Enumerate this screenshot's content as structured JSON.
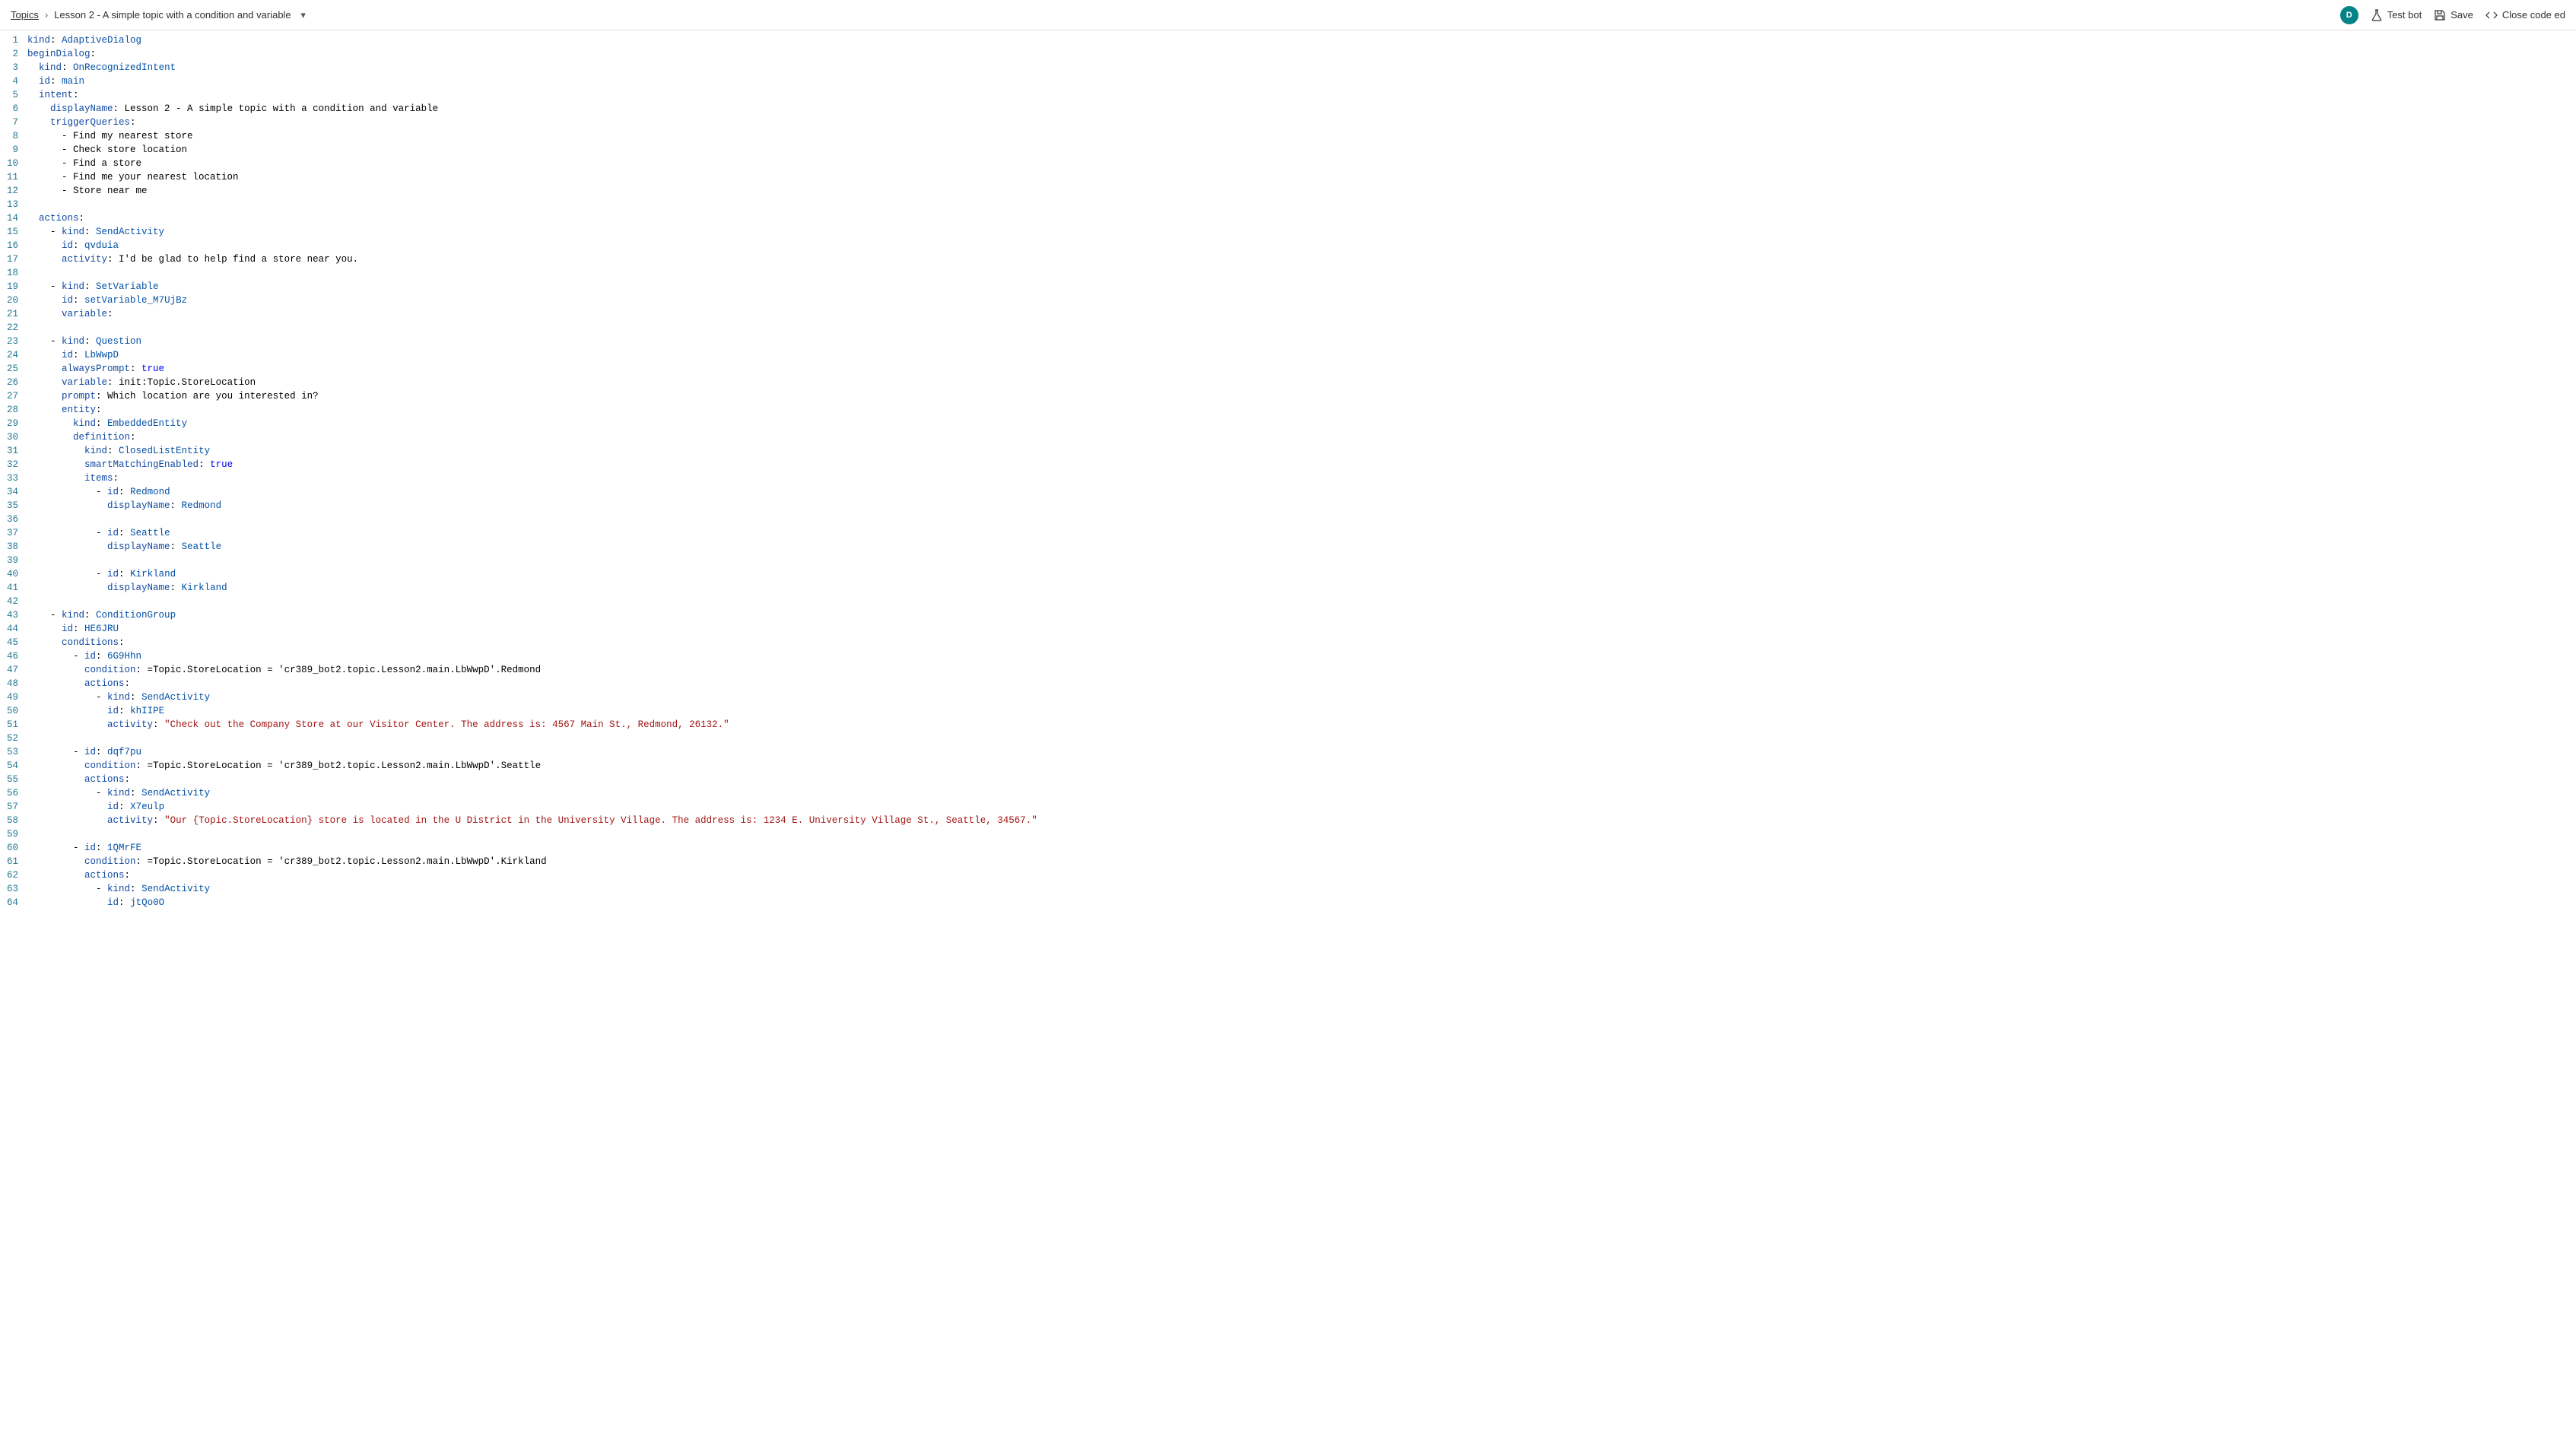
{
  "breadcrumb": {
    "root": "Topics",
    "current": "Lesson 2 - A simple topic with a condition and variable"
  },
  "avatar_initial": "D",
  "toolbar": {
    "test_bot": "Test bot",
    "save": "Save",
    "close_code": "Close code ed"
  },
  "code": {
    "lines": [
      {
        "n": 1,
        "tokens": [
          [
            "k",
            "kind"
          ],
          [
            "p",
            ": "
          ],
          [
            "v",
            "AdaptiveDialog"
          ]
        ]
      },
      {
        "n": 2,
        "tokens": [
          [
            "k",
            "beginDialog"
          ],
          [
            "p",
            ":"
          ]
        ]
      },
      {
        "n": 3,
        "tokens": [
          [
            "p",
            "  "
          ],
          [
            "k",
            "kind"
          ],
          [
            "p",
            ": "
          ],
          [
            "v",
            "OnRecognizedIntent"
          ]
        ]
      },
      {
        "n": 4,
        "tokens": [
          [
            "p",
            "  "
          ],
          [
            "k",
            "id"
          ],
          [
            "p",
            ": "
          ],
          [
            "v",
            "main"
          ]
        ]
      },
      {
        "n": 5,
        "tokens": [
          [
            "p",
            "  "
          ],
          [
            "k",
            "intent"
          ],
          [
            "p",
            ":"
          ]
        ]
      },
      {
        "n": 6,
        "tokens": [
          [
            "p",
            "    "
          ],
          [
            "k",
            "displayName"
          ],
          [
            "p",
            ": "
          ],
          [
            "c",
            "Lesson 2 - A simple topic with a condition and variable"
          ]
        ]
      },
      {
        "n": 7,
        "tokens": [
          [
            "p",
            "    "
          ],
          [
            "k",
            "triggerQueries"
          ],
          [
            "p",
            ":"
          ]
        ]
      },
      {
        "n": 8,
        "tokens": [
          [
            "p",
            "      - "
          ],
          [
            "c",
            "Find my nearest store"
          ]
        ]
      },
      {
        "n": 9,
        "tokens": [
          [
            "p",
            "      - "
          ],
          [
            "c",
            "Check store location"
          ]
        ]
      },
      {
        "n": 10,
        "tokens": [
          [
            "p",
            "      - "
          ],
          [
            "c",
            "Find a store"
          ]
        ]
      },
      {
        "n": 11,
        "tokens": [
          [
            "p",
            "      - "
          ],
          [
            "c",
            "Find me your nearest location"
          ]
        ]
      },
      {
        "n": 12,
        "tokens": [
          [
            "p",
            "      - "
          ],
          [
            "c",
            "Store near me"
          ]
        ]
      },
      {
        "n": 13,
        "tokens": []
      },
      {
        "n": 14,
        "tokens": [
          [
            "p",
            "  "
          ],
          [
            "k",
            "actions"
          ],
          [
            "p",
            ":"
          ]
        ]
      },
      {
        "n": 15,
        "tokens": [
          [
            "p",
            "    - "
          ],
          [
            "k",
            "kind"
          ],
          [
            "p",
            ": "
          ],
          [
            "v",
            "SendActivity"
          ]
        ]
      },
      {
        "n": 16,
        "tokens": [
          [
            "p",
            "      "
          ],
          [
            "k",
            "id"
          ],
          [
            "p",
            ": "
          ],
          [
            "v",
            "qvduia"
          ]
        ]
      },
      {
        "n": 17,
        "tokens": [
          [
            "p",
            "      "
          ],
          [
            "k",
            "activity"
          ],
          [
            "p",
            ": "
          ],
          [
            "c",
            "I'd be glad to help find a store near you."
          ]
        ]
      },
      {
        "n": 18,
        "tokens": []
      },
      {
        "n": 19,
        "tokens": [
          [
            "p",
            "    - "
          ],
          [
            "k",
            "kind"
          ],
          [
            "p",
            ": "
          ],
          [
            "v",
            "SetVariable"
          ]
        ]
      },
      {
        "n": 20,
        "tokens": [
          [
            "p",
            "      "
          ],
          [
            "k",
            "id"
          ],
          [
            "p",
            ": "
          ],
          [
            "v",
            "setVariable_M7UjBz"
          ]
        ]
      },
      {
        "n": 21,
        "tokens": [
          [
            "p",
            "      "
          ],
          [
            "k",
            "variable"
          ],
          [
            "p",
            ": "
          ]
        ]
      },
      {
        "n": 22,
        "tokens": []
      },
      {
        "n": 23,
        "tokens": [
          [
            "p",
            "    - "
          ],
          [
            "k",
            "kind"
          ],
          [
            "p",
            ": "
          ],
          [
            "v",
            "Question"
          ]
        ]
      },
      {
        "n": 24,
        "tokens": [
          [
            "p",
            "      "
          ],
          [
            "k",
            "id"
          ],
          [
            "p",
            ": "
          ],
          [
            "v",
            "LbWwpD"
          ]
        ]
      },
      {
        "n": 25,
        "tokens": [
          [
            "p",
            "      "
          ],
          [
            "k",
            "alwaysPrompt"
          ],
          [
            "p",
            ": "
          ],
          [
            "b",
            "true"
          ]
        ]
      },
      {
        "n": 26,
        "tokens": [
          [
            "p",
            "      "
          ],
          [
            "k",
            "variable"
          ],
          [
            "p",
            ": "
          ],
          [
            "c",
            "init:Topic.StoreLocation"
          ]
        ]
      },
      {
        "n": 27,
        "tokens": [
          [
            "p",
            "      "
          ],
          [
            "k",
            "prompt"
          ],
          [
            "p",
            ": "
          ],
          [
            "c",
            "Which location are you interested in?"
          ]
        ]
      },
      {
        "n": 28,
        "tokens": [
          [
            "p",
            "      "
          ],
          [
            "k",
            "entity"
          ],
          [
            "p",
            ":"
          ]
        ]
      },
      {
        "n": 29,
        "tokens": [
          [
            "p",
            "        "
          ],
          [
            "k",
            "kind"
          ],
          [
            "p",
            ": "
          ],
          [
            "v",
            "EmbeddedEntity"
          ]
        ]
      },
      {
        "n": 30,
        "tokens": [
          [
            "p",
            "        "
          ],
          [
            "k",
            "definition"
          ],
          [
            "p",
            ":"
          ]
        ]
      },
      {
        "n": 31,
        "tokens": [
          [
            "p",
            "          "
          ],
          [
            "k",
            "kind"
          ],
          [
            "p",
            ": "
          ],
          [
            "v",
            "ClosedListEntity"
          ]
        ]
      },
      {
        "n": 32,
        "tokens": [
          [
            "p",
            "          "
          ],
          [
            "k",
            "smartMatchingEnabled"
          ],
          [
            "p",
            ": "
          ],
          [
            "b",
            "true"
          ]
        ]
      },
      {
        "n": 33,
        "tokens": [
          [
            "p",
            "          "
          ],
          [
            "k",
            "items"
          ],
          [
            "p",
            ":"
          ]
        ]
      },
      {
        "n": 34,
        "tokens": [
          [
            "p",
            "            - "
          ],
          [
            "k",
            "id"
          ],
          [
            "p",
            ": "
          ],
          [
            "v",
            "Redmond"
          ]
        ]
      },
      {
        "n": 35,
        "tokens": [
          [
            "p",
            "              "
          ],
          [
            "k",
            "displayName"
          ],
          [
            "p",
            ": "
          ],
          [
            "v",
            "Redmond"
          ]
        ]
      },
      {
        "n": 36,
        "tokens": []
      },
      {
        "n": 37,
        "tokens": [
          [
            "p",
            "            - "
          ],
          [
            "k",
            "id"
          ],
          [
            "p",
            ": "
          ],
          [
            "v",
            "Seattle"
          ]
        ]
      },
      {
        "n": 38,
        "tokens": [
          [
            "p",
            "              "
          ],
          [
            "k",
            "displayName"
          ],
          [
            "p",
            ": "
          ],
          [
            "v",
            "Seattle"
          ]
        ]
      },
      {
        "n": 39,
        "tokens": []
      },
      {
        "n": 40,
        "tokens": [
          [
            "p",
            "            - "
          ],
          [
            "k",
            "id"
          ],
          [
            "p",
            ": "
          ],
          [
            "v",
            "Kirkland"
          ]
        ]
      },
      {
        "n": 41,
        "tokens": [
          [
            "p",
            "              "
          ],
          [
            "k",
            "displayName"
          ],
          [
            "p",
            ": "
          ],
          [
            "v",
            "Kirkland"
          ]
        ]
      },
      {
        "n": 42,
        "tokens": []
      },
      {
        "n": 43,
        "tokens": [
          [
            "p",
            "    - "
          ],
          [
            "k",
            "kind"
          ],
          [
            "p",
            ": "
          ],
          [
            "v",
            "ConditionGroup"
          ]
        ]
      },
      {
        "n": 44,
        "tokens": [
          [
            "p",
            "      "
          ],
          [
            "k",
            "id"
          ],
          [
            "p",
            ": "
          ],
          [
            "v",
            "HE6JRU"
          ]
        ]
      },
      {
        "n": 45,
        "tokens": [
          [
            "p",
            "      "
          ],
          [
            "k",
            "conditions"
          ],
          [
            "p",
            ":"
          ]
        ]
      },
      {
        "n": 46,
        "tokens": [
          [
            "p",
            "        - "
          ],
          [
            "k",
            "id"
          ],
          [
            "p",
            ": "
          ],
          [
            "v",
            "6G9Hhn"
          ]
        ]
      },
      {
        "n": 47,
        "tokens": [
          [
            "p",
            "          "
          ],
          [
            "k",
            "condition"
          ],
          [
            "p",
            ": "
          ],
          [
            "c",
            "=Topic.StoreLocation = 'cr389_bot2.topic.Lesson2.main.LbWwpD'.Redmond"
          ]
        ]
      },
      {
        "n": 48,
        "tokens": [
          [
            "p",
            "          "
          ],
          [
            "k",
            "actions"
          ],
          [
            "p",
            ":"
          ]
        ]
      },
      {
        "n": 49,
        "tokens": [
          [
            "p",
            "            - "
          ],
          [
            "k",
            "kind"
          ],
          [
            "p",
            ": "
          ],
          [
            "v",
            "SendActivity"
          ]
        ]
      },
      {
        "n": 50,
        "tokens": [
          [
            "p",
            "              "
          ],
          [
            "k",
            "id"
          ],
          [
            "p",
            ": "
          ],
          [
            "v",
            "khIIPE"
          ]
        ]
      },
      {
        "n": 51,
        "tokens": [
          [
            "p",
            "              "
          ],
          [
            "k",
            "activity"
          ],
          [
            "p",
            ": "
          ],
          [
            "s",
            "\"Check out the Company Store at our Visitor Center. The address is: 4567 Main St., Redmond, 26132.\""
          ]
        ]
      },
      {
        "n": 52,
        "tokens": []
      },
      {
        "n": 53,
        "tokens": [
          [
            "p",
            "        - "
          ],
          [
            "k",
            "id"
          ],
          [
            "p",
            ": "
          ],
          [
            "v",
            "dqf7pu"
          ]
        ]
      },
      {
        "n": 54,
        "tokens": [
          [
            "p",
            "          "
          ],
          [
            "k",
            "condition"
          ],
          [
            "p",
            ": "
          ],
          [
            "c",
            "=Topic.StoreLocation = 'cr389_bot2.topic.Lesson2.main.LbWwpD'.Seattle"
          ]
        ]
      },
      {
        "n": 55,
        "tokens": [
          [
            "p",
            "          "
          ],
          [
            "k",
            "actions"
          ],
          [
            "p",
            ":"
          ]
        ]
      },
      {
        "n": 56,
        "tokens": [
          [
            "p",
            "            - "
          ],
          [
            "k",
            "kind"
          ],
          [
            "p",
            ": "
          ],
          [
            "v",
            "SendActivity"
          ]
        ]
      },
      {
        "n": 57,
        "tokens": [
          [
            "p",
            "              "
          ],
          [
            "k",
            "id"
          ],
          [
            "p",
            ": "
          ],
          [
            "v",
            "X7eulp"
          ]
        ]
      },
      {
        "n": 58,
        "tokens": [
          [
            "p",
            "              "
          ],
          [
            "k",
            "activity"
          ],
          [
            "p",
            ": "
          ],
          [
            "s",
            "\"Our {Topic.StoreLocation} store is located in the U District in the University Village. The address is: 1234 E. University Village St., Seattle, 34567.\""
          ]
        ]
      },
      {
        "n": 59,
        "tokens": []
      },
      {
        "n": 60,
        "tokens": [
          [
            "p",
            "        - "
          ],
          [
            "k",
            "id"
          ],
          [
            "p",
            ": "
          ],
          [
            "v",
            "1QMrFE"
          ]
        ]
      },
      {
        "n": 61,
        "tokens": [
          [
            "p",
            "          "
          ],
          [
            "k",
            "condition"
          ],
          [
            "p",
            ": "
          ],
          [
            "c",
            "=Topic.StoreLocation = 'cr389_bot2.topic.Lesson2.main.LbWwpD'.Kirkland"
          ]
        ]
      },
      {
        "n": 62,
        "tokens": [
          [
            "p",
            "          "
          ],
          [
            "k",
            "actions"
          ],
          [
            "p",
            ":"
          ]
        ]
      },
      {
        "n": 63,
        "tokens": [
          [
            "p",
            "            - "
          ],
          [
            "k",
            "kind"
          ],
          [
            "p",
            ": "
          ],
          [
            "v",
            "SendActivity"
          ]
        ]
      },
      {
        "n": 64,
        "tokens": [
          [
            "p",
            "              "
          ],
          [
            "k",
            "id"
          ],
          [
            "p",
            ": "
          ],
          [
            "v",
            "jtQo0O"
          ]
        ]
      }
    ]
  }
}
